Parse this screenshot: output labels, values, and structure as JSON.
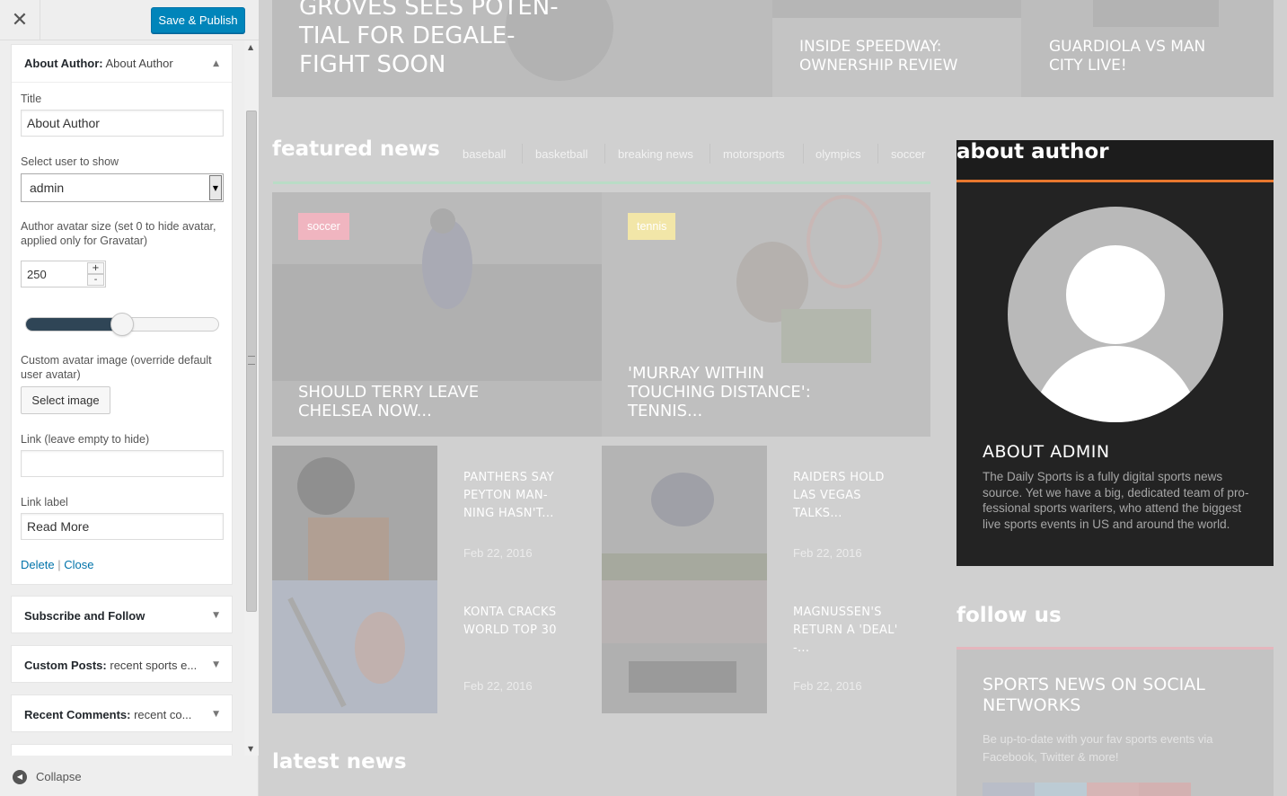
{
  "customizer": {
    "close_symbol": "✕",
    "save_publish": "Save & Publish",
    "about_widget": {
      "header_bold": "About Author:",
      "header_sub": "About Author",
      "title_label": "Title",
      "title_value": "About Author",
      "user_label": "Select user to show",
      "user_value": "admin",
      "avatar_size_label": "Author avatar size (set 0 to hide avatar, applied only for Gravatar)",
      "avatar_size_value": "250",
      "avatar_size_fraction": 0.5,
      "custom_avatar_label": "Custom avatar image (override default user avatar)",
      "select_image": "Select image",
      "link_label": "Link (leave empty to hide)",
      "link_value": "",
      "link_text_label": "Link label",
      "link_text_value": "Read More",
      "delete": "Delete",
      "separator": "|",
      "close": "Close"
    },
    "other_widgets": [
      {
        "bold": "Subscribe and Follow",
        "sub": ""
      },
      {
        "bold": "Custom Posts:",
        "sub": "recent sports e..."
      },
      {
        "bold": "Recent Comments:",
        "sub": "recent co..."
      }
    ],
    "collapse": "Collapse"
  },
  "preview": {
    "hero": [
      {
        "title": "GROVES SEES POTEN-\nTIAL FOR DEGALE-\nFIGHT SOON"
      },
      {
        "title": "INSIDE SPEEDWAY:\nOWNERSHIP REVIEW"
      },
      {
        "title": "GUARDIOLA VS MAN\nCITY LIVE!"
      }
    ],
    "featured_title": "featured news",
    "categories": [
      "baseball",
      "basketball",
      "breaking news",
      "motorsports",
      "olympics",
      "soccer"
    ],
    "big_cards": [
      {
        "badge": "soccer",
        "badge_color": "#f0b5c0",
        "title": "SHOULD TERRY LEAVE\nCHELSEA NOW..."
      },
      {
        "badge": "tennis",
        "badge_color": "#f2e6a8",
        "title": "'MURRAY WITHIN\nTOUCHING DISTANCE':\nTENNIS..."
      }
    ],
    "small_cards": [
      {
        "title": "PANTHERS SAY PEYTON MAN-NING HASN'T...",
        "date": "Feb 22, 2016"
      },
      {
        "title": "RAIDERS HOLD LAS VEGAS TALKS...",
        "date": "Feb 22, 2016"
      },
      {
        "title": "KONTA CRACKS WORLD TOP 30",
        "date": "Feb 22, 2016"
      },
      {
        "title": "MAGNUSSEN'S RETURN A 'DEAL' -...",
        "date": "Feb 22, 2016"
      }
    ],
    "latest_title": "latest news",
    "about": {
      "title": "about author",
      "name": "ABOUT ADMIN",
      "bio": "The Daily Sports is a fully digital sports news source. Yet we have a big, dedicated team of pro-fessional sports wariters, who attend the biggest live sports events in US and around the world."
    },
    "follow": {
      "title": "follow us",
      "heading": "SPORTS NEWS ON SOCIAL NETWORKS",
      "text": "Be up-to-date with your fav sports events via Facebook, Twitter & more!"
    }
  },
  "colors": {
    "wp_blue": "#0085ba",
    "accent_orange": "#e8772e",
    "accent_green_rule": "#b9dcc6",
    "follow_rule": "#e4b6bd",
    "overlay_gray": "#d0d0d0"
  }
}
